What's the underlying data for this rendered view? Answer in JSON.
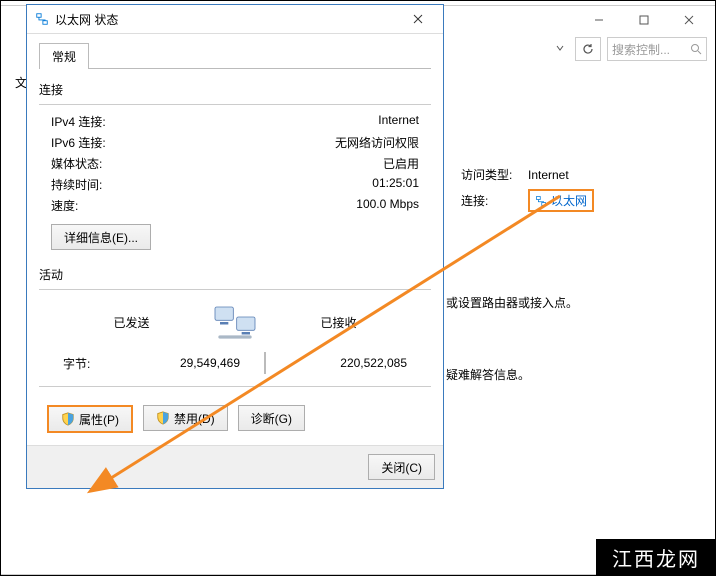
{
  "bg": {
    "search_placeholder": "搜索控制...",
    "access_type_label": "访问类型:",
    "access_type_value": "Internet",
    "connection_label": "连接:",
    "connection_value": "以太网",
    "hint1": "或设置路由器或接入点。",
    "hint2": "疑难解答信息。",
    "side_text": "文"
  },
  "dlg": {
    "title": "以太网 状态",
    "tab": "常规",
    "conn_section": "连接",
    "ipv4_label": "IPv4 连接:",
    "ipv4_value": "Internet",
    "ipv6_label": "IPv6 连接:",
    "ipv6_value": "无网络访问权限",
    "media_label": "媒体状态:",
    "media_value": "已启用",
    "duration_label": "持续时间:",
    "duration_value": "01:25:01",
    "speed_label": "速度:",
    "speed_value": "100.0 Mbps",
    "details_btn": "详细信息(E)...",
    "activity_section": "活动",
    "sent_label": "已发送",
    "recv_label": "已接收",
    "bytes_label": "字节:",
    "bytes_sent": "29,549,469",
    "bytes_recv": "220,522,085",
    "properties_btn": "属性(P)",
    "disable_btn": "禁用(D)",
    "diagnose_btn": "诊断(G)",
    "close_btn": "关闭(C)"
  },
  "watermark": "江西龙网"
}
